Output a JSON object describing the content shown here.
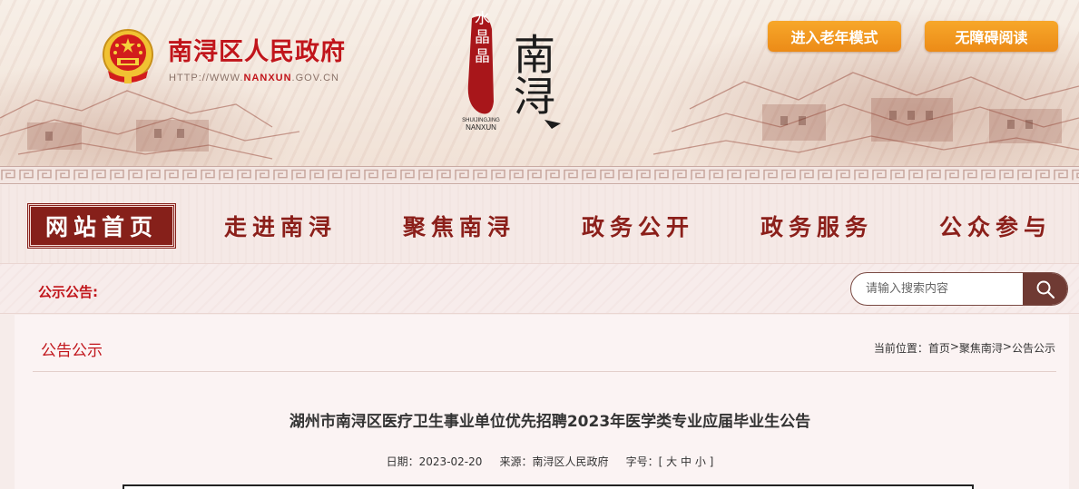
{
  "header": {
    "site_name": "南浔区人民政府",
    "url_prefix": "HTTP://WWW.",
    "url_domain": "NANXUN",
    "url_suffix": ".GOV.CN",
    "calligraphy_small": "水晶晶",
    "calligraphy_sub1": "SHUIJINGJING",
    "calligraphy_sub2": "NANXUN",
    "calligraphy_main": "南浔",
    "btn_elder": "进入老年模式",
    "btn_access": "无障碍阅读"
  },
  "nav": {
    "items": [
      "网站首页",
      "走进南浔",
      "聚焦南浔",
      "政务公开",
      "政务服务",
      "公众参与"
    ]
  },
  "notice": {
    "label": "公示公告:",
    "search_placeholder": "请输入搜索内容"
  },
  "article": {
    "column_title": "公告公示",
    "breadcrumb_prefix": "当前位置：",
    "breadcrumb": [
      "首页",
      "聚焦南浔",
      "公告公示"
    ],
    "breadcrumb_sep": ">",
    "title": "湖州市南浔区医疗卫生事业单位优先招聘2023年医学类专业应届毕业生公告",
    "date_label": "日期：",
    "date": "2023-02-20",
    "source_label": "来源：",
    "source": "南浔区人民政府",
    "fontsize_label": "字号：",
    "fs_open": "[",
    "fs_large": "大",
    "fs_medium": "中",
    "fs_small": "小",
    "fs_close": "]"
  },
  "colors": {
    "brand_red": "#c1151b",
    "nav_dark": "#86201a",
    "button_orange": "#ec8b17"
  }
}
